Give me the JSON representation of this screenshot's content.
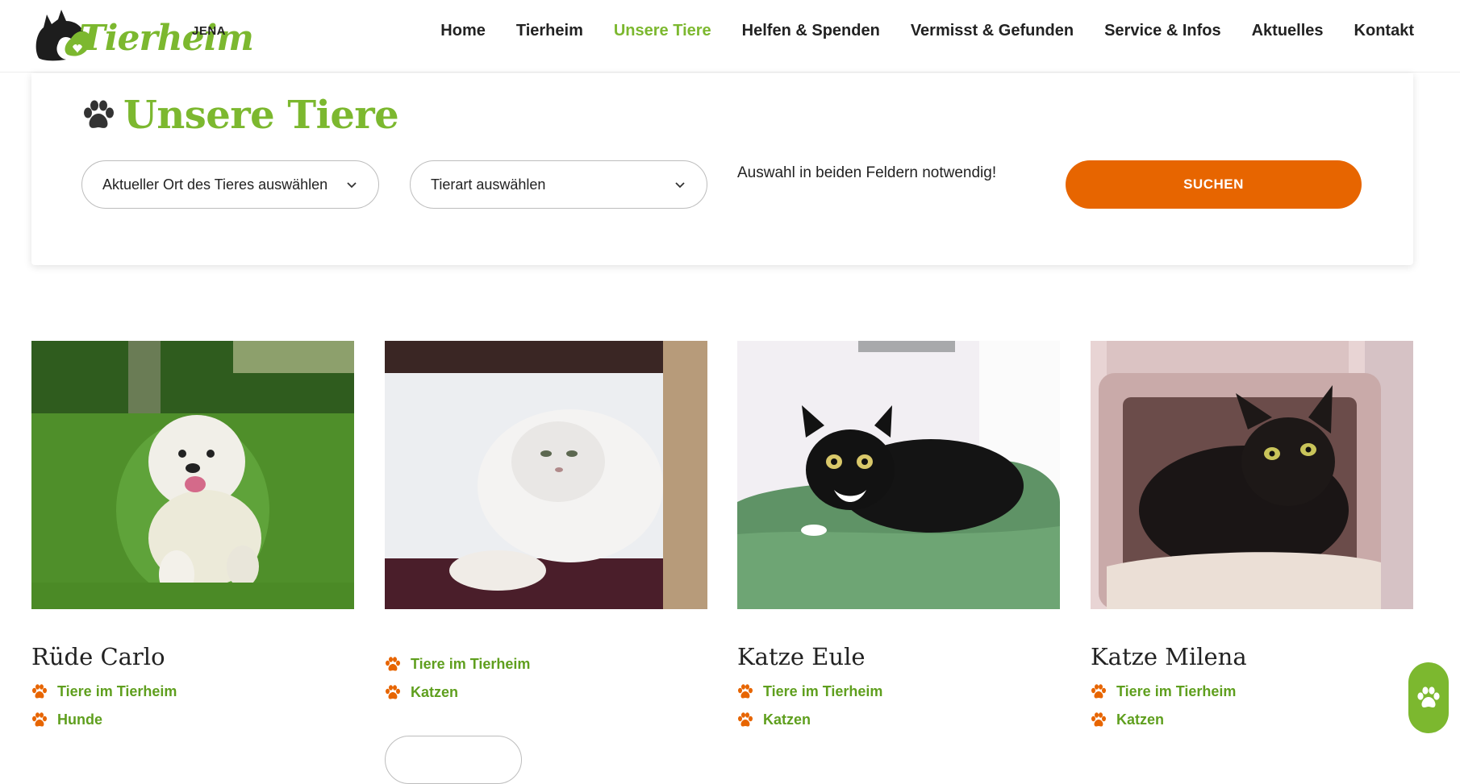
{
  "header": {
    "logo_text": "Tierheim",
    "logo_sub": "JENA",
    "nav": [
      {
        "label": "Home",
        "active": false
      },
      {
        "label": "Tierheim",
        "active": false
      },
      {
        "label": "Unsere Tiere",
        "active": true
      },
      {
        "label": "Helfen & Spenden",
        "active": false
      },
      {
        "label": "Vermisst & Gefunden",
        "active": false
      },
      {
        "label": "Service & Infos",
        "active": false
      },
      {
        "label": "Aktuelles",
        "active": false
      },
      {
        "label": "Kontakt",
        "active": false
      }
    ]
  },
  "search": {
    "title": "Unsere Tiere",
    "select_location": "Aktueller Ort des Tieres auswählen",
    "select_species": "Tierart auswählen",
    "hint": "Auswahl in beiden Feldern notwendig!",
    "button": "SUCHEN"
  },
  "animals": [
    {
      "name": "Rüde Carlo",
      "tags": [
        "Tiere im Tierheim",
        "Hunde"
      ],
      "photo_icon": "dog-photo"
    },
    {
      "name": "",
      "tags": [
        "Tiere im Tierheim",
        "Katzen"
      ],
      "photo_icon": "white-cat-photo"
    },
    {
      "name": "Katze Eule",
      "tags": [
        "Tiere im Tierheim",
        "Katzen"
      ],
      "photo_icon": "black-white-cat-photo"
    },
    {
      "name": "Katze Milena",
      "tags": [
        "Tiere im Tierheim",
        "Katzen"
      ],
      "photo_icon": "black-cat-photo"
    }
  ],
  "colors": {
    "brand_green": "#7cb82f",
    "tag_green": "#5f9f1e",
    "accent_orange": "#e76500"
  }
}
